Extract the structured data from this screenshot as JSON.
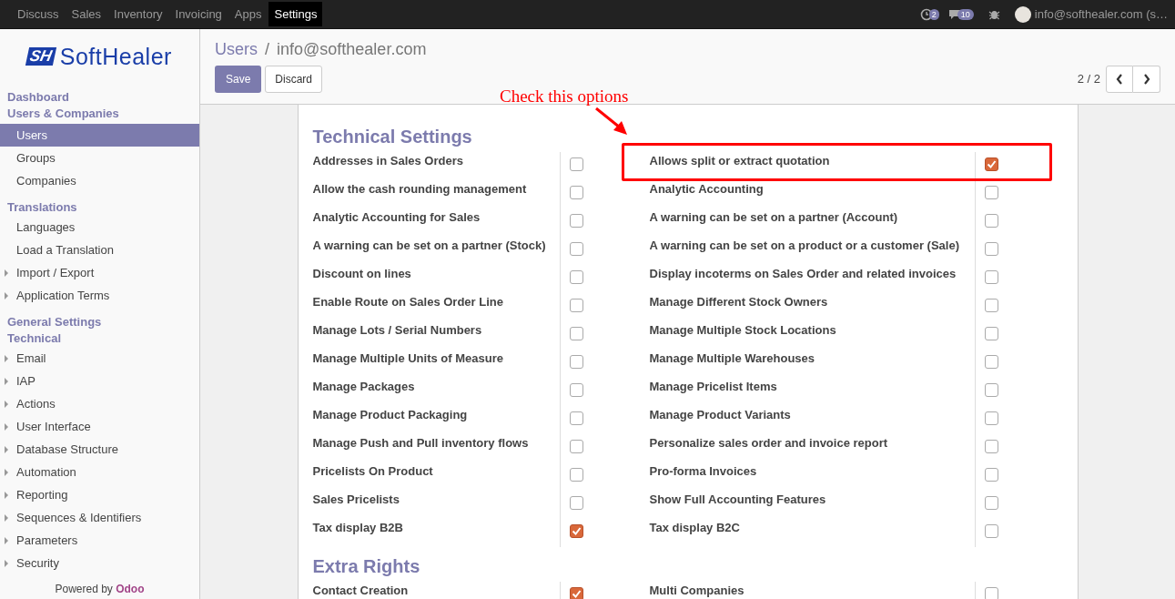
{
  "top_menu": [
    {
      "label": "Discuss",
      "selected": false
    },
    {
      "label": "Sales",
      "selected": false
    },
    {
      "label": "Inventory",
      "selected": false
    },
    {
      "label": "Invoicing",
      "selected": false
    },
    {
      "label": "Apps",
      "selected": false
    },
    {
      "label": "Settings",
      "selected": true
    }
  ],
  "systray": {
    "activity_count": "2",
    "message_count": "10",
    "user": "info@softhealer.com (s…"
  },
  "logo": {
    "mark": "SH",
    "name": "SoftHealer"
  },
  "sidebar": [
    {
      "kind": "header",
      "label": "Dashboard"
    },
    {
      "kind": "header",
      "label": "Users & Companies"
    },
    {
      "kind": "item",
      "label": "Users",
      "selected": true
    },
    {
      "kind": "item",
      "label": "Groups",
      "selected": false
    },
    {
      "kind": "item",
      "label": "Companies",
      "selected": false
    },
    {
      "kind": "header",
      "label": "Translations"
    },
    {
      "kind": "item",
      "label": "Languages",
      "selected": false
    },
    {
      "kind": "item",
      "label": "Load a Translation",
      "selected": false
    },
    {
      "kind": "folder",
      "label": "Import / Export",
      "expanded": false
    },
    {
      "kind": "folder",
      "label": "Application Terms",
      "expanded": false
    },
    {
      "kind": "header",
      "label": "General Settings"
    },
    {
      "kind": "header",
      "label": "Technical"
    },
    {
      "kind": "folder",
      "label": "Email",
      "expanded": false
    },
    {
      "kind": "folder",
      "label": "IAP",
      "expanded": false
    },
    {
      "kind": "folder",
      "label": "Actions",
      "expanded": false
    },
    {
      "kind": "folder",
      "label": "User Interface",
      "expanded": false
    },
    {
      "kind": "folder",
      "label": "Database Structure",
      "expanded": false
    },
    {
      "kind": "folder",
      "label": "Automation",
      "expanded": false
    },
    {
      "kind": "folder",
      "label": "Reporting",
      "expanded": false
    },
    {
      "kind": "folder",
      "label": "Sequences & Identifiers",
      "expanded": false
    },
    {
      "kind": "folder",
      "label": "Parameters",
      "expanded": false
    },
    {
      "kind": "folder",
      "label": "Security",
      "expanded": false
    }
  ],
  "powered_by": "Powered by **Odoo**",
  "breadcrumb": {
    "parent": "Users",
    "separator": "/",
    "current": "info@softhealer.com"
  },
  "buttons": {
    "save": "Save",
    "discard": "Discard"
  },
  "pager": {
    "value": "2 / 2"
  },
  "annotation": {
    "text": "Check this options"
  },
  "sections": [
    {
      "title": "Technical Settings",
      "rows": [
        {
          "left": {
            "label": "Addresses in Sales Orders",
            "checked": false
          },
          "right": {
            "label": "Allows split or extract quotation",
            "checked": true
          }
        },
        {
          "left": {
            "label": "Allow the cash rounding management",
            "checked": false
          },
          "right": {
            "label": "Analytic Accounting",
            "checked": false
          }
        },
        {
          "left": {
            "label": "Analytic Accounting for Sales",
            "checked": false
          },
          "right": {
            "label": "A warning can be set on a partner (Account)",
            "checked": false
          }
        },
        {
          "left": {
            "label": "A warning can be set on a partner (Stock)",
            "checked": false
          },
          "right": {
            "label": "A warning can be set on a product or a customer (Sale)",
            "checked": false
          }
        },
        {
          "left": {
            "label": "Discount on lines",
            "checked": false
          },
          "right": {
            "label": "Display incoterms on Sales Order and related invoices",
            "checked": false
          }
        },
        {
          "left": {
            "label": "Enable Route on Sales Order Line",
            "checked": false
          },
          "right": {
            "label": "Manage Different Stock Owners",
            "checked": false
          }
        },
        {
          "left": {
            "label": "Manage Lots / Serial Numbers",
            "checked": false
          },
          "right": {
            "label": "Manage Multiple Stock Locations",
            "checked": false
          }
        },
        {
          "left": {
            "label": "Manage Multiple Units of Measure",
            "checked": false
          },
          "right": {
            "label": "Manage Multiple Warehouses",
            "checked": false
          }
        },
        {
          "left": {
            "label": "Manage Packages",
            "checked": false
          },
          "right": {
            "label": "Manage Pricelist Items",
            "checked": false
          }
        },
        {
          "left": {
            "label": "Manage Product Packaging",
            "checked": false
          },
          "right": {
            "label": "Manage Product Variants",
            "checked": false
          }
        },
        {
          "left": {
            "label": "Manage Push and Pull inventory flows",
            "checked": false
          },
          "right": {
            "label": "Personalize sales order and invoice report",
            "checked": false
          }
        },
        {
          "left": {
            "label": "Pricelists On Product",
            "checked": false
          },
          "right": {
            "label": "Pro-forma Invoices",
            "checked": false
          }
        },
        {
          "left": {
            "label": "Sales Pricelists",
            "checked": false
          },
          "right": {
            "label": "Show Full Accounting Features",
            "checked": false
          }
        },
        {
          "left": {
            "label": "Tax display B2B",
            "checked": true
          },
          "right": {
            "label": "Tax display B2C",
            "checked": false
          }
        }
      ]
    },
    {
      "title": "Extra Rights",
      "rows": [
        {
          "left": {
            "label": "Contact Creation",
            "checked": true
          },
          "right": {
            "label": "Multi Companies",
            "checked": false
          }
        }
      ]
    }
  ]
}
